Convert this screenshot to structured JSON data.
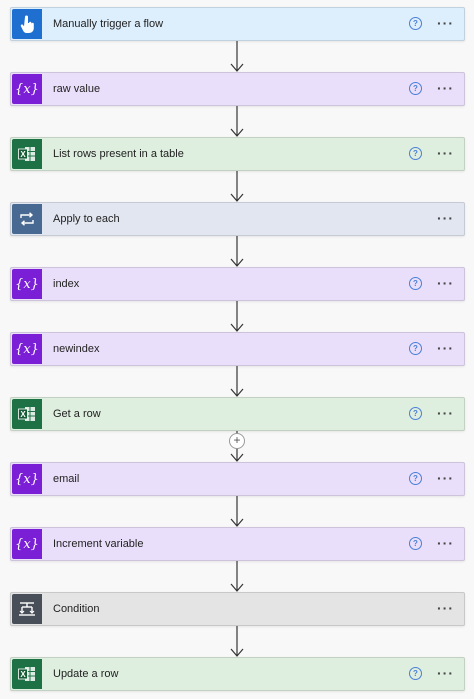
{
  "flow": {
    "steps": [
      {
        "label": "Manually trigger a flow",
        "icon": "hand-tap-icon",
        "kind": "trigger",
        "has_help": true,
        "help_glyph": "?",
        "more_glyph": "···"
      },
      {
        "label": "raw value",
        "icon": "variable-icon",
        "kind": "var",
        "has_help": true,
        "help_glyph": "?",
        "more_glyph": "···"
      },
      {
        "label": "List rows present in a table",
        "icon": "excel-icon",
        "kind": "excel",
        "has_help": true,
        "help_glyph": "?",
        "more_glyph": "···"
      },
      {
        "label": "Apply to each",
        "icon": "loop-icon",
        "kind": "loop",
        "has_help": false,
        "more_glyph": "···"
      },
      {
        "label": "index",
        "icon": "variable-icon",
        "kind": "var",
        "has_help": true,
        "help_glyph": "?",
        "more_glyph": "···"
      },
      {
        "label": "newindex",
        "icon": "variable-icon",
        "kind": "var",
        "has_help": true,
        "help_glyph": "?",
        "more_glyph": "···"
      },
      {
        "label": "Get a row",
        "icon": "excel-icon",
        "kind": "excel",
        "has_help": true,
        "help_glyph": "?",
        "more_glyph": "···"
      },
      {
        "label": "email",
        "icon": "variable-icon",
        "kind": "var",
        "has_help": true,
        "help_glyph": "?",
        "more_glyph": "···"
      },
      {
        "label": "Increment variable",
        "icon": "variable-icon",
        "kind": "var",
        "has_help": true,
        "help_glyph": "?",
        "more_glyph": "···"
      },
      {
        "label": "Condition",
        "icon": "condition-icon",
        "kind": "cond",
        "has_help": false,
        "more_glyph": "···"
      },
      {
        "label": "Update a row",
        "icon": "excel-icon",
        "kind": "excel",
        "has_help": true,
        "help_glyph": "?",
        "more_glyph": "···"
      }
    ],
    "insert_glyph": "+"
  },
  "colors": {
    "trigger_icon": "#1f6fd1",
    "variable_icon": "#7a1fd6",
    "excel_icon": "#1e7145",
    "loop_icon": "#486991",
    "condition_icon": "#484f58"
  }
}
